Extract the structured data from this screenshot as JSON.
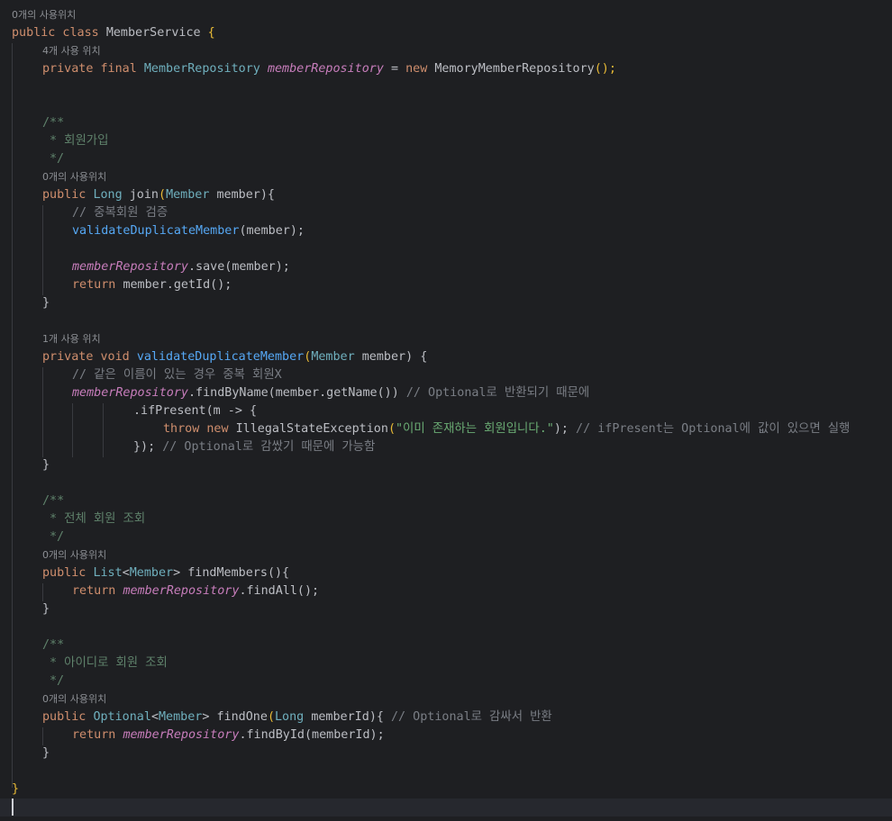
{
  "hints": {
    "class_usages": "0개의 사용위치",
    "field_usages": "4개 사용 위치",
    "join_usages": "0개의 사용위치",
    "validate_usages": "1개 사용 위치",
    "findMembers_usages": "0개의 사용위치",
    "findOne_usages": "0개의 사용위치"
  },
  "code": {
    "class_decl": [
      "public class ",
      "MemberService",
      " {"
    ],
    "field_decl": [
      "private final ",
      "MemberRepository ",
      "memberRepository",
      " = ",
      "new ",
      "MemoryMemberRepository",
      "();"
    ],
    "doc_open_1": "/**",
    "doc_join": "* 회원가입",
    "doc_close_1": "*/",
    "join_sig": [
      "public ",
      "Long ",
      "join",
      "(",
      "Member ",
      "member",
      "){"
    ],
    "join_c1": "// 중복회원 검증",
    "join_l1": [
      "validateDuplicateMember",
      "(member);"
    ],
    "join_l2": [
      "memberRepository",
      ".save(member);"
    ],
    "join_l3": [
      "return ",
      "member.getId();"
    ],
    "close_brace": "}",
    "validate_sig": [
      "private void ",
      "validateDuplicateMember",
      "(",
      "Member ",
      "member",
      ") {"
    ],
    "validate_c1": "// 같은 이름이 있는 경우 중복 회원X",
    "validate_l1": [
      "memberRepository",
      ".findByName(member.getName()) ",
      "// Optional로 반환되기 때문에"
    ],
    "validate_l2": [
      ".ifPresent(m -> {"
    ],
    "validate_l3": [
      "throw new ",
      "IllegalStateException",
      "(",
      "\"이미 존재하는 회원입니다.\"",
      "); ",
      "// ifPresent는 Optional에 값이 있으면 실행"
    ],
    "validate_l4": [
      "}); ",
      "// Optional로 감쌌기 때문에 가능함"
    ],
    "doc_findMembers": "* 전체 회원 조회",
    "findMembers_sig": [
      "public ",
      "List",
      "<",
      "Member",
      "> ",
      "findMembers",
      "(){"
    ],
    "findMembers_l1": [
      "return ",
      "memberRepository",
      ".findAll();"
    ],
    "doc_findOne": "* 아이디로 회원 조회",
    "findOne_sig": [
      "public ",
      "Optional",
      "<",
      "Member",
      "> ",
      "findOne",
      "(",
      "Long ",
      "memberId",
      "){ ",
      "// Optional로 감싸서 반환"
    ],
    "findOne_l1": [
      "return ",
      "memberRepository",
      ".findById(memberId);"
    ],
    "class_close": "}"
  },
  "colors": {
    "background": "#1e1f22",
    "keyword": "#cf8e6d",
    "field": "#c77dbb",
    "method": "#56a8f5",
    "string": "#6aab73",
    "comment": "#7a7e85",
    "doc_comment": "#5f826b",
    "bracket": "#e8ba36"
  }
}
